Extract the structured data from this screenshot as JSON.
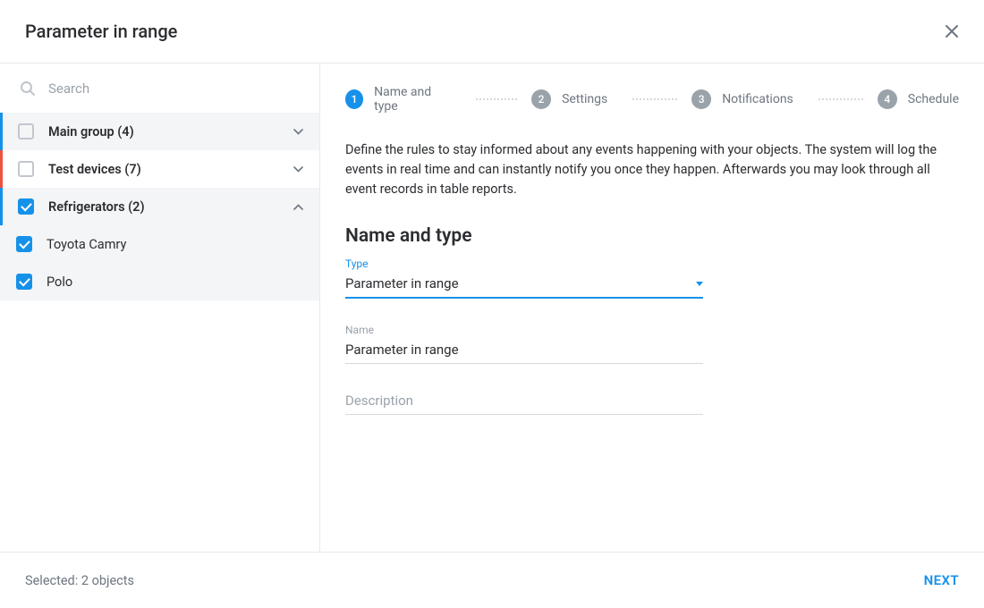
{
  "header": {
    "title": "Parameter in range"
  },
  "search": {
    "placeholder": "Search"
  },
  "tree": {
    "groups": [
      {
        "label": "Main group (4)",
        "checked": false,
        "expanded": false,
        "accent": "blue"
      },
      {
        "label": "Test devices (7)",
        "checked": false,
        "expanded": false,
        "accent": "red"
      },
      {
        "label": "Refrigerators (2)",
        "checked": true,
        "expanded": true,
        "accent": "blue"
      }
    ],
    "children": [
      {
        "label": "Toyota Camry",
        "checked": true
      },
      {
        "label": "Polo",
        "checked": true
      }
    ]
  },
  "stepper": [
    {
      "num": "1",
      "label": "Name and type",
      "active": true
    },
    {
      "num": "2",
      "label": "Settings",
      "active": false
    },
    {
      "num": "3",
      "label": "Notifications",
      "active": false
    },
    {
      "num": "4",
      "label": "Schedule",
      "active": false
    }
  ],
  "intro": "Define the rules to stay informed about any events happening with your objects. The system will log the events in real time and can instantly notify you once they happen. Afterwards you may look through all event records in table reports.",
  "section_title": "Name and type",
  "fields": {
    "type_label": "Type",
    "type_value": "Parameter in range",
    "name_label": "Name",
    "name_value": "Parameter in range",
    "desc_placeholder": "Description"
  },
  "footer": {
    "selected": "Selected: 2 objects",
    "next": "NEXT"
  }
}
